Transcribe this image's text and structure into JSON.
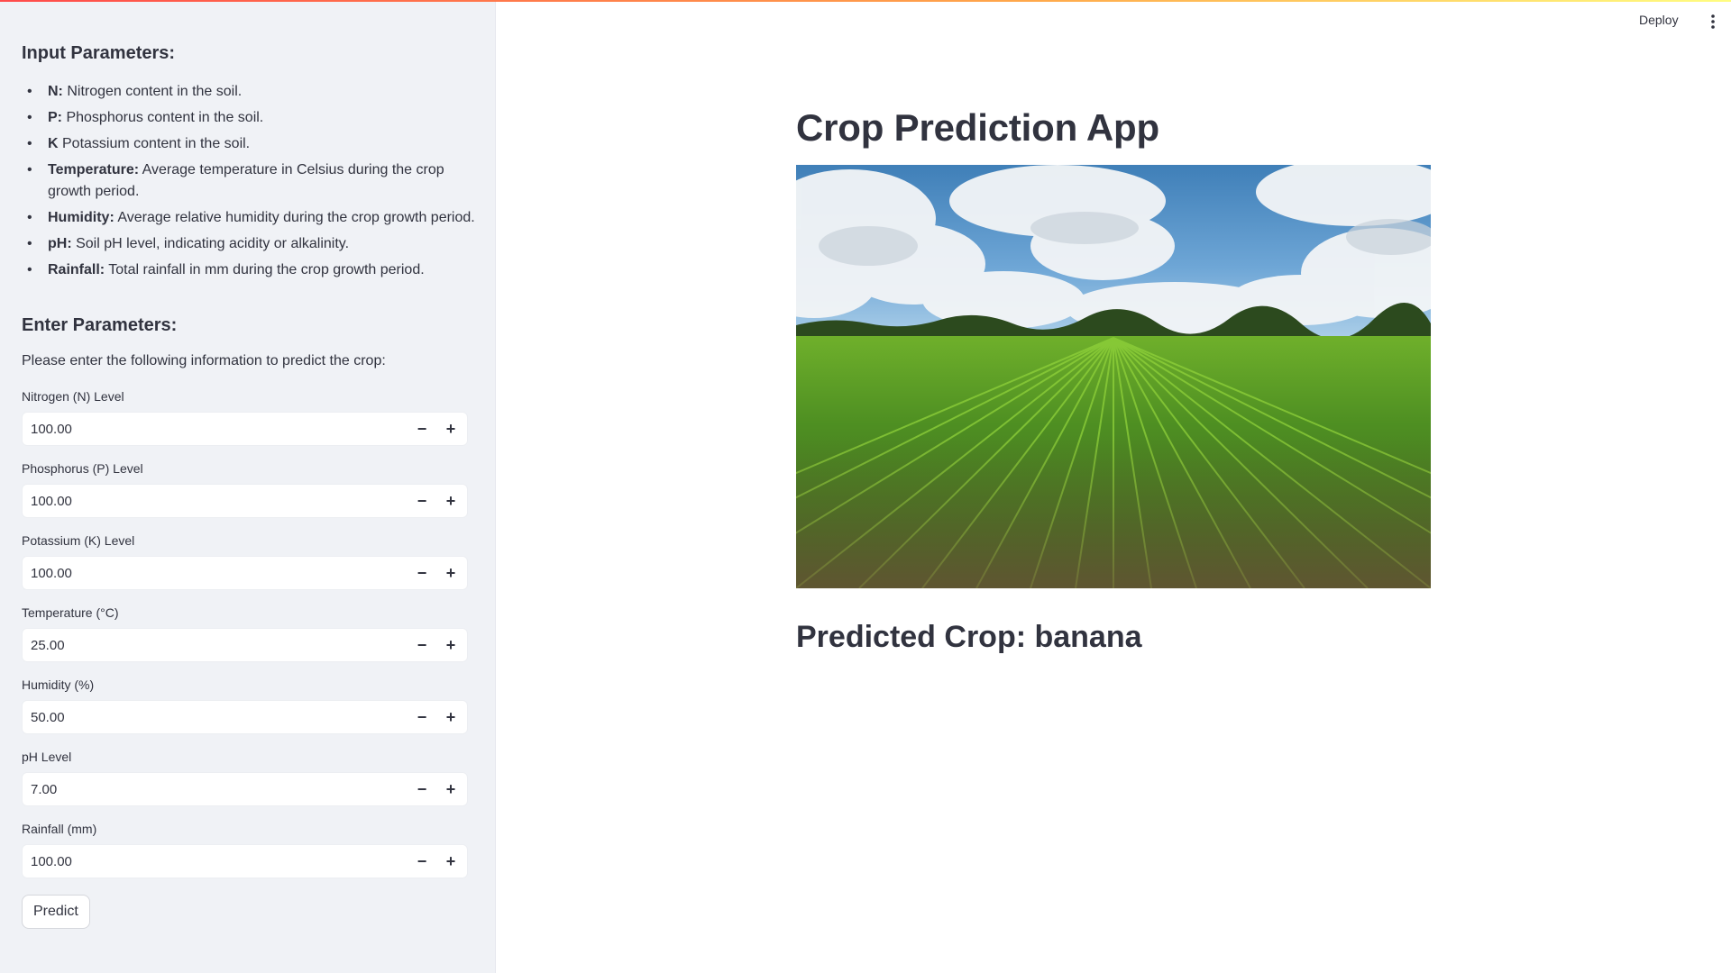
{
  "sidebar": {
    "input_heading": "Input Parameters:",
    "params": [
      {
        "term": "N:",
        "desc": " Nitrogen content in the soil."
      },
      {
        "term": "P:",
        "desc": " Phosphorus content in the soil."
      },
      {
        "term": "K",
        "desc": " Potassium content in the soil."
      },
      {
        "term": "Temperature:",
        "desc": " Average temperature in Celsius during the crop growth period."
      },
      {
        "term": "Humidity:",
        "desc": " Average relative humidity during the crop growth period."
      },
      {
        "term": "pH:",
        "desc": " Soil pH level, indicating acidity or alkalinity."
      },
      {
        "term": "Rainfall:",
        "desc": " Total rainfall in mm during the crop growth period."
      }
    ],
    "enter_heading": "Enter Parameters:",
    "instructions": "Please enter the following information to predict the crop:",
    "fields": [
      {
        "label": "Nitrogen (N) Level",
        "value": "100.00"
      },
      {
        "label": "Phosphorus (P) Level",
        "value": "100.00"
      },
      {
        "label": "Potassium (K) Level",
        "value": "100.00"
      },
      {
        "label": "Temperature (°C)",
        "value": "25.00"
      },
      {
        "label": "Humidity (%)",
        "value": "50.00"
      },
      {
        "label": "pH Level",
        "value": "7.00"
      },
      {
        "label": "Rainfall (mm)",
        "value": "100.00"
      }
    ],
    "predict_label": "Predict"
  },
  "header": {
    "deploy_label": "Deploy"
  },
  "main": {
    "title": "Crop Prediction App",
    "result": "Predicted Crop: banana"
  },
  "colors": {
    "sidebar_bg": "#f0f2f6",
    "text": "#31333f",
    "accent_gradient_start": "#ff4b4b",
    "accent_gradient_end": "#fffd80"
  },
  "icons": {
    "menu": "vertical-dots-icon",
    "decrement": "minus-icon",
    "increment": "plus-icon"
  }
}
